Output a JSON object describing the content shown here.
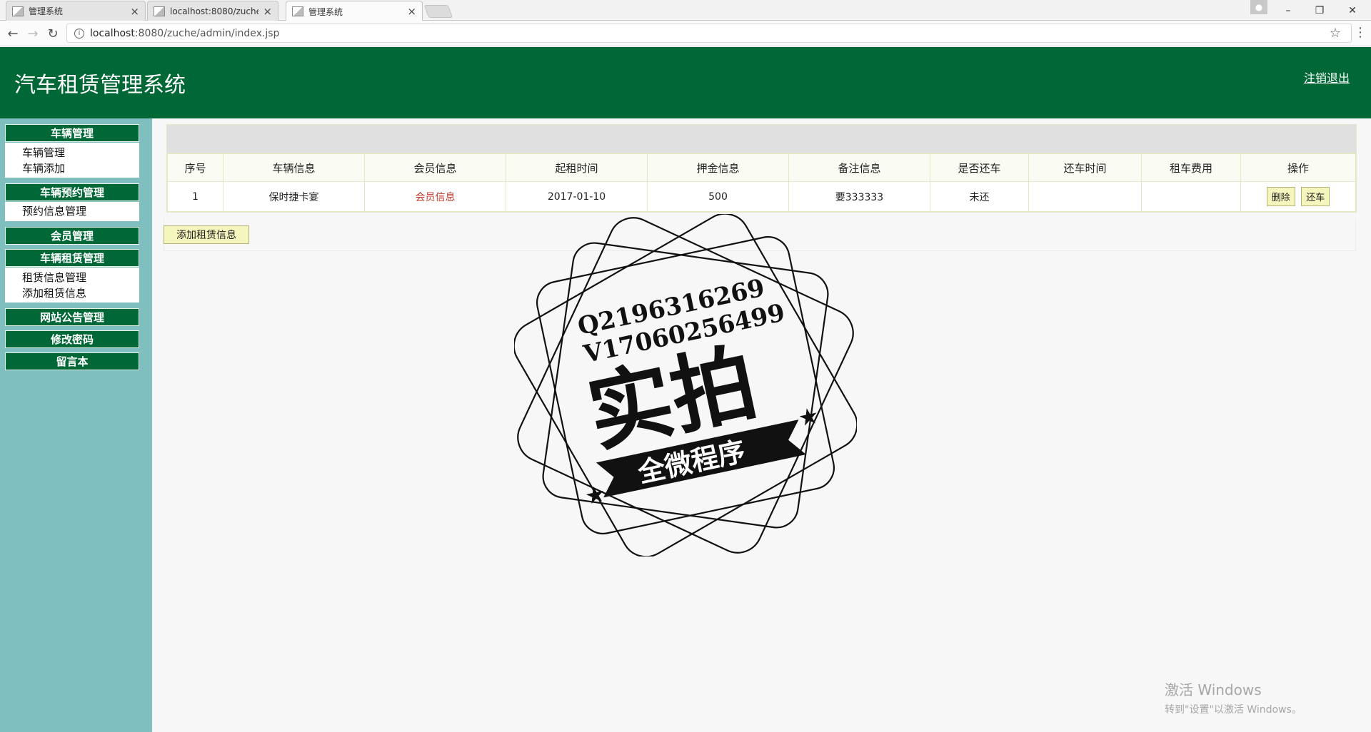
{
  "browser": {
    "tabs": [
      {
        "label": "管理系统",
        "close": "×"
      },
      {
        "label": "localhost:8080/zuche/",
        "close": "×"
      },
      {
        "label": "管理系统",
        "close": "×"
      }
    ],
    "url_host": "localhost",
    "url_rest": ":8080/zuche/admin/index.jsp",
    "window_controls": {
      "minimize": "–",
      "restore": "❐",
      "close": "✕"
    }
  },
  "header": {
    "title": "汽车租赁管理系统",
    "logout": "注销退出"
  },
  "sidebar": {
    "sections": [
      {
        "title": "车辆管理",
        "items": [
          "车辆管理",
          "车辆添加"
        ]
      },
      {
        "title": "车辆预约管理",
        "items": [
          "预约信息管理"
        ]
      },
      {
        "title": "会员管理",
        "items": []
      },
      {
        "title": "车辆租赁管理",
        "items": [
          "租赁信息管理",
          "添加租赁信息"
        ]
      },
      {
        "title": "网站公告管理",
        "items": []
      },
      {
        "title": "修改密码",
        "items": []
      },
      {
        "title": "留言本",
        "items": []
      }
    ]
  },
  "table": {
    "headers": [
      "序号",
      "车辆信息",
      "会员信息",
      "起租时间",
      "押金信息",
      "备注信息",
      "是否还车",
      "还车时间",
      "租车费用",
      "操作"
    ],
    "rows": [
      {
        "index": "1",
        "car": "保时捷卡宴",
        "member": "会员信息",
        "start": "2017-01-10",
        "deposit": "500",
        "remark": "要333333",
        "returned": "未还",
        "return_time": "",
        "fee": "",
        "delete_label": "删除",
        "return_label": "还车"
      }
    ]
  },
  "add_button": "添加租赁信息",
  "stamp": {
    "line1": "Q2196316269",
    "line2": "V17060256499",
    "big": "实拍",
    "banner": "全微程序"
  },
  "watermark": {
    "line1": "激活 Windows",
    "line2": "转到\"设置\"以激活 Windows。"
  },
  "colors": {
    "header_green": "#006837",
    "sidebar_teal": "#80bfc0",
    "button_yellow": "#f4f6bd"
  }
}
